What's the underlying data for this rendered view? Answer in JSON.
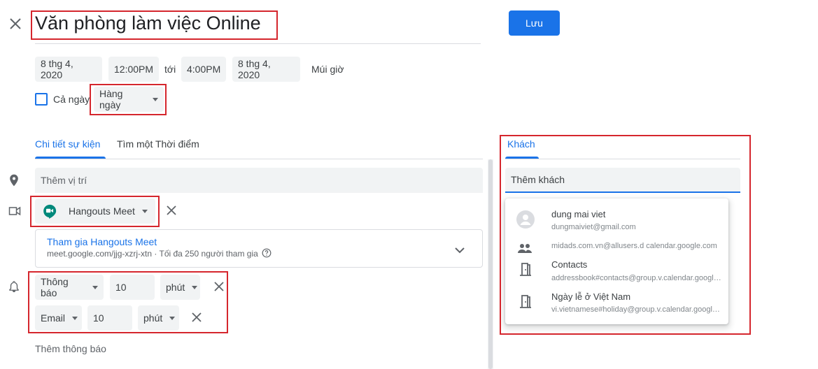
{
  "header": {
    "title": "Văn phòng làm việc Online",
    "save_label": "Lưu"
  },
  "datetime": {
    "start_date": "8 thg 4, 2020",
    "start_time": "12:00PM",
    "to_label": "tới",
    "end_time": "4:00PM",
    "end_date": "8 thg 4, 2020",
    "timezone_label": "Múi giờ",
    "all_day_label": "Cả ngày",
    "recurrence": "Hàng ngày"
  },
  "tabs": {
    "details": "Chi tiết sự kiện",
    "find_time": "Tìm một Thời điểm",
    "guests": "Khách"
  },
  "location": {
    "placeholder": "Thêm vị trí"
  },
  "conference": {
    "provider": "Hangouts Meet",
    "join_label": "Tham gia Hangouts Meet",
    "meet_info": "meet.google.com/jjg-xzrj-xtn · Tối đa 250 người tham gia"
  },
  "notifications": [
    {
      "type": "Thông báo",
      "value": "10",
      "unit": "phút"
    },
    {
      "type": "Email",
      "value": "10",
      "unit": "phút"
    }
  ],
  "add_notification_label": "Thêm thông báo",
  "guests": {
    "input_placeholder": "Thêm khách",
    "suggestions": [
      {
        "name": "dung mai viet",
        "email": "dungmaiviet@gmail.com",
        "icon": "avatar-icon"
      },
      {
        "name": "",
        "email": "midads.com.vn@allusers.d calendar.google.com",
        "icon": "group-icon"
      },
      {
        "name": "Contacts",
        "email": "addressbook#contacts@group.v.calendar.google.com",
        "icon": "calendar-door-icon"
      },
      {
        "name": "Ngày lễ ở Việt Nam",
        "email": "vi.vietnamese#holiday@group.v.calendar.google.com",
        "icon": "calendar-door-icon"
      }
    ]
  },
  "colors": {
    "accent": "#1a73e8",
    "highlight": "#d5262d"
  }
}
